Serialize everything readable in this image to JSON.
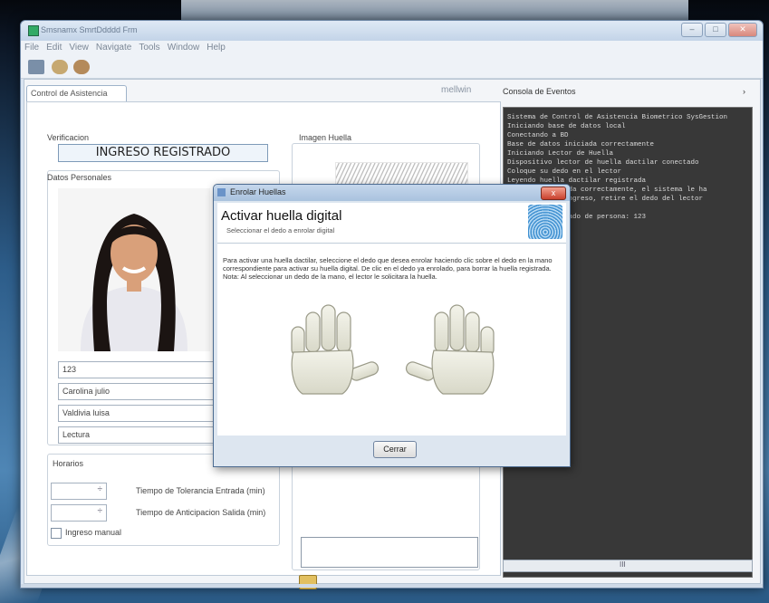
{
  "window": {
    "title": "Smsnamx SmrtDdddd Frm"
  },
  "menu": [
    "File",
    "Edit",
    "View",
    "Navigate",
    "Tools",
    "Window",
    "Help"
  ],
  "left_panel": {
    "tab_label": "Control de Asistencia",
    "toolbar_right": "mellwin",
    "verification_label": "Verificacion",
    "verification_status": "INGRESO REGISTRADO",
    "personal_data_label": "Datos Personales",
    "fields": [
      "123",
      "Carolina julio",
      "Valdivia luisa",
      "Lectura"
    ],
    "horarios_label": "Horarios",
    "spinner1_suffix": "÷",
    "spinner2_suffix": "÷",
    "label_tolerance": "Tiempo de Tolerancia Entrada (min)",
    "label_exit": "Tiempo de Anticipacion Salida (min)",
    "checkbox_label": "Ingreso manual",
    "fingerprint_label": "Imagen Huella"
  },
  "console": {
    "header": "Consola de Eventos",
    "lines": [
      "Sistema de Control de Asistencia Biometrico SysGestion",
      "Iniciando base de datos local",
      "Conectando a BD",
      "Base de datos iniciada correctamente",
      "Iniciando Lector de Huella",
      "Dispositivo lector de huella dactilar conectado",
      "Coloque su dedo en el lector",
      "Leyendo huella dactilar registrada",
      "Huella verificada correctamente, el sistema le ha",
      "registrado su ingreso, retire el dedo del lector",
      "",
      "Ingreso registrado de persona: 123"
    ],
    "scroll_label": "III"
  },
  "dialog": {
    "title": "Enrolar Huellas",
    "close_glyph": "x",
    "heading": "Activar huella digital",
    "subheading": "Seleccionar el dedo a enrolar digital",
    "description": "Para activar una huella dactilar, seleccione el dedo que desea enrolar haciendo clic sobre el dedo en la mano correspondiente para activar su huella digital. De clic en el dedo ya enrolado, para borrar la huella registrada. Nota: Al seleccionar un dedo de la mano, el lector le solicitara la huella.",
    "button": "Cerrar"
  },
  "colors": {
    "accent": "#3d8fd0",
    "console_bg": "#383838",
    "close_red": "#c9402c"
  }
}
